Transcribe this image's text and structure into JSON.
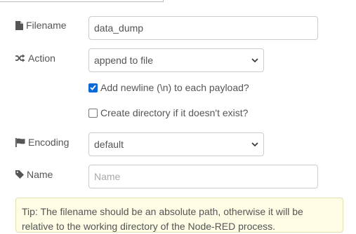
{
  "form": {
    "filename": {
      "label": "Filename",
      "icon": "file-icon",
      "value": "data_dump"
    },
    "action": {
      "label": "Action",
      "icon": "shuffle-icon",
      "value": "append to file"
    },
    "add_newline": {
      "label": "Add newline (\\n) to each payload?",
      "checked": true
    },
    "create_dir": {
      "label": "Create directory if it doesn't exist?",
      "checked": false
    },
    "encoding": {
      "label": "Encoding",
      "icon": "flag-icon",
      "value": "default"
    },
    "name": {
      "label": "Name",
      "icon": "tag-icon",
      "placeholder": "Name",
      "value": ""
    }
  },
  "tip": {
    "text": "Tip: The filename should be an absolute path, otherwise it will be relative to the working directory of the Node-RED process."
  },
  "colors": {
    "checkbox_accent": "#0b69d6",
    "tip_background": "#fefce5"
  }
}
